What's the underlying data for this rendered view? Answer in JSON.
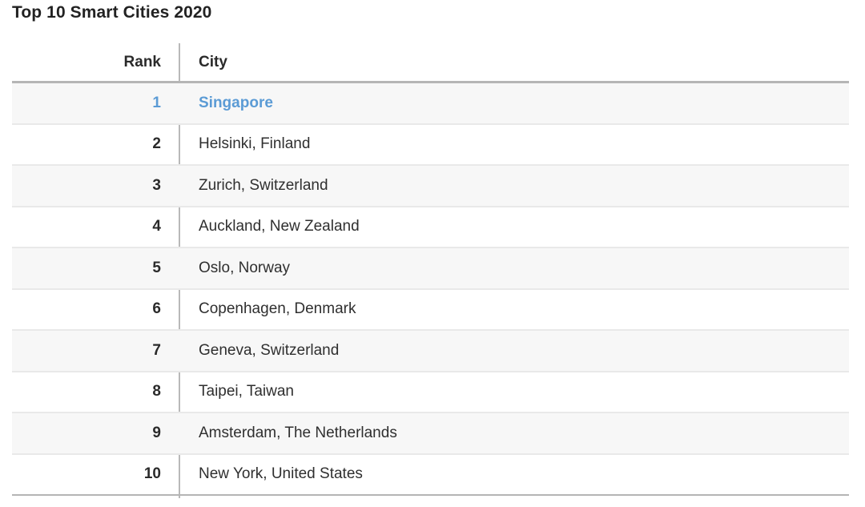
{
  "title": "Top 10 Smart Cities 2020",
  "colors": {
    "accent": "#5b9bd5"
  },
  "table": {
    "columns": {
      "rank": "Rank",
      "city": "City"
    },
    "rows": [
      {
        "rank": "1",
        "city": "Singapore"
      },
      {
        "rank": "2",
        "city": "Helsinki, Finland"
      },
      {
        "rank": "3",
        "city": "Zurich, Switzerland"
      },
      {
        "rank": "4",
        "city": "Auckland, New Zealand"
      },
      {
        "rank": "5",
        "city": "Oslo, Norway"
      },
      {
        "rank": "6",
        "city": "Copenhagen, Denmark"
      },
      {
        "rank": "7",
        "city": "Geneva, Switzerland"
      },
      {
        "rank": "8",
        "city": "Taipei, Taiwan"
      },
      {
        "rank": "9",
        "city": "Amsterdam, The Netherlands"
      },
      {
        "rank": "10",
        "city": "New York, United States"
      }
    ]
  }
}
